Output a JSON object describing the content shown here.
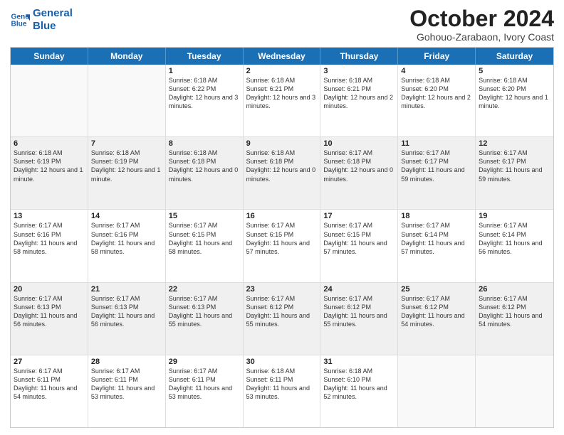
{
  "logo": {
    "line1": "General",
    "line2": "Blue"
  },
  "title": "October 2024",
  "subtitle": "Gohouo-Zarabaon, Ivory Coast",
  "days": [
    "Sunday",
    "Monday",
    "Tuesday",
    "Wednesday",
    "Thursday",
    "Friday",
    "Saturday"
  ],
  "weeks": [
    [
      {
        "day": "",
        "info": ""
      },
      {
        "day": "",
        "info": ""
      },
      {
        "day": "1",
        "info": "Sunrise: 6:18 AM\nSunset: 6:22 PM\nDaylight: 12 hours and 3 minutes."
      },
      {
        "day": "2",
        "info": "Sunrise: 6:18 AM\nSunset: 6:21 PM\nDaylight: 12 hours and 3 minutes."
      },
      {
        "day": "3",
        "info": "Sunrise: 6:18 AM\nSunset: 6:21 PM\nDaylight: 12 hours and 2 minutes."
      },
      {
        "day": "4",
        "info": "Sunrise: 6:18 AM\nSunset: 6:20 PM\nDaylight: 12 hours and 2 minutes."
      },
      {
        "day": "5",
        "info": "Sunrise: 6:18 AM\nSunset: 6:20 PM\nDaylight: 12 hours and 1 minute."
      }
    ],
    [
      {
        "day": "6",
        "info": "Sunrise: 6:18 AM\nSunset: 6:19 PM\nDaylight: 12 hours and 1 minute."
      },
      {
        "day": "7",
        "info": "Sunrise: 6:18 AM\nSunset: 6:19 PM\nDaylight: 12 hours and 1 minute."
      },
      {
        "day": "8",
        "info": "Sunrise: 6:18 AM\nSunset: 6:18 PM\nDaylight: 12 hours and 0 minutes."
      },
      {
        "day": "9",
        "info": "Sunrise: 6:18 AM\nSunset: 6:18 PM\nDaylight: 12 hours and 0 minutes."
      },
      {
        "day": "10",
        "info": "Sunrise: 6:17 AM\nSunset: 6:18 PM\nDaylight: 12 hours and 0 minutes."
      },
      {
        "day": "11",
        "info": "Sunrise: 6:17 AM\nSunset: 6:17 PM\nDaylight: 11 hours and 59 minutes."
      },
      {
        "day": "12",
        "info": "Sunrise: 6:17 AM\nSunset: 6:17 PM\nDaylight: 11 hours and 59 minutes."
      }
    ],
    [
      {
        "day": "13",
        "info": "Sunrise: 6:17 AM\nSunset: 6:16 PM\nDaylight: 11 hours and 58 minutes."
      },
      {
        "day": "14",
        "info": "Sunrise: 6:17 AM\nSunset: 6:16 PM\nDaylight: 11 hours and 58 minutes."
      },
      {
        "day": "15",
        "info": "Sunrise: 6:17 AM\nSunset: 6:15 PM\nDaylight: 11 hours and 58 minutes."
      },
      {
        "day": "16",
        "info": "Sunrise: 6:17 AM\nSunset: 6:15 PM\nDaylight: 11 hours and 57 minutes."
      },
      {
        "day": "17",
        "info": "Sunrise: 6:17 AM\nSunset: 6:15 PM\nDaylight: 11 hours and 57 minutes."
      },
      {
        "day": "18",
        "info": "Sunrise: 6:17 AM\nSunset: 6:14 PM\nDaylight: 11 hours and 57 minutes."
      },
      {
        "day": "19",
        "info": "Sunrise: 6:17 AM\nSunset: 6:14 PM\nDaylight: 11 hours and 56 minutes."
      }
    ],
    [
      {
        "day": "20",
        "info": "Sunrise: 6:17 AM\nSunset: 6:13 PM\nDaylight: 11 hours and 56 minutes."
      },
      {
        "day": "21",
        "info": "Sunrise: 6:17 AM\nSunset: 6:13 PM\nDaylight: 11 hours and 56 minutes."
      },
      {
        "day": "22",
        "info": "Sunrise: 6:17 AM\nSunset: 6:13 PM\nDaylight: 11 hours and 55 minutes."
      },
      {
        "day": "23",
        "info": "Sunrise: 6:17 AM\nSunset: 6:12 PM\nDaylight: 11 hours and 55 minutes."
      },
      {
        "day": "24",
        "info": "Sunrise: 6:17 AM\nSunset: 6:12 PM\nDaylight: 11 hours and 55 minutes."
      },
      {
        "day": "25",
        "info": "Sunrise: 6:17 AM\nSunset: 6:12 PM\nDaylight: 11 hours and 54 minutes."
      },
      {
        "day": "26",
        "info": "Sunrise: 6:17 AM\nSunset: 6:12 PM\nDaylight: 11 hours and 54 minutes."
      }
    ],
    [
      {
        "day": "27",
        "info": "Sunrise: 6:17 AM\nSunset: 6:11 PM\nDaylight: 11 hours and 54 minutes."
      },
      {
        "day": "28",
        "info": "Sunrise: 6:17 AM\nSunset: 6:11 PM\nDaylight: 11 hours and 53 minutes."
      },
      {
        "day": "29",
        "info": "Sunrise: 6:17 AM\nSunset: 6:11 PM\nDaylight: 11 hours and 53 minutes."
      },
      {
        "day": "30",
        "info": "Sunrise: 6:18 AM\nSunset: 6:11 PM\nDaylight: 11 hours and 53 minutes."
      },
      {
        "day": "31",
        "info": "Sunrise: 6:18 AM\nSunset: 6:10 PM\nDaylight: 11 hours and 52 minutes."
      },
      {
        "day": "",
        "info": ""
      },
      {
        "day": "",
        "info": ""
      }
    ]
  ]
}
